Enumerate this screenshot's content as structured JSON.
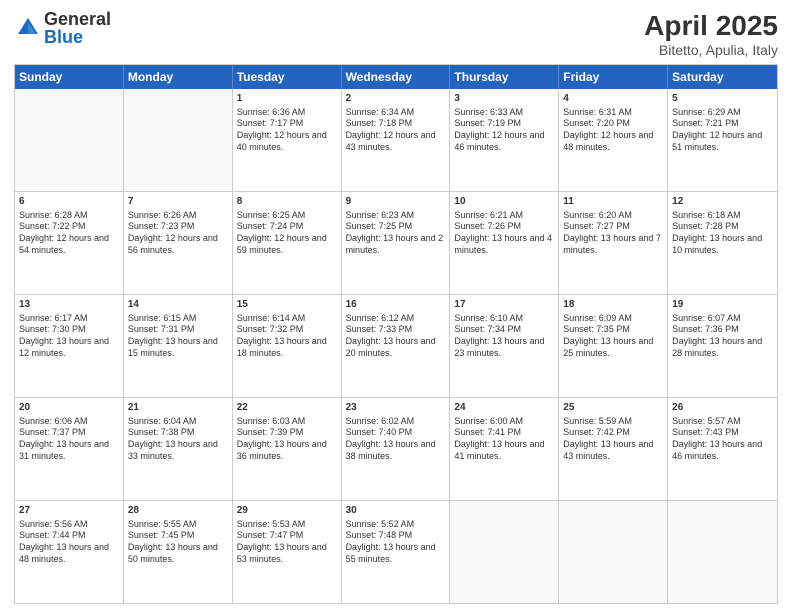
{
  "logo": {
    "general": "General",
    "blue": "Blue"
  },
  "title": "April 2025",
  "location": "Bitetto, Apulia, Italy",
  "weekdays": [
    "Sunday",
    "Monday",
    "Tuesday",
    "Wednesday",
    "Thursday",
    "Friday",
    "Saturday"
  ],
  "weeks": [
    [
      {
        "day": "",
        "info": ""
      },
      {
        "day": "",
        "info": ""
      },
      {
        "day": "1",
        "info": "Sunrise: 6:36 AM\nSunset: 7:17 PM\nDaylight: 12 hours and 40 minutes."
      },
      {
        "day": "2",
        "info": "Sunrise: 6:34 AM\nSunset: 7:18 PM\nDaylight: 12 hours and 43 minutes."
      },
      {
        "day": "3",
        "info": "Sunrise: 6:33 AM\nSunset: 7:19 PM\nDaylight: 12 hours and 46 minutes."
      },
      {
        "day": "4",
        "info": "Sunrise: 6:31 AM\nSunset: 7:20 PM\nDaylight: 12 hours and 48 minutes."
      },
      {
        "day": "5",
        "info": "Sunrise: 6:29 AM\nSunset: 7:21 PM\nDaylight: 12 hours and 51 minutes."
      }
    ],
    [
      {
        "day": "6",
        "info": "Sunrise: 6:28 AM\nSunset: 7:22 PM\nDaylight: 12 hours and 54 minutes."
      },
      {
        "day": "7",
        "info": "Sunrise: 6:26 AM\nSunset: 7:23 PM\nDaylight: 12 hours and 56 minutes."
      },
      {
        "day": "8",
        "info": "Sunrise: 6:25 AM\nSunset: 7:24 PM\nDaylight: 12 hours and 59 minutes."
      },
      {
        "day": "9",
        "info": "Sunrise: 6:23 AM\nSunset: 7:25 PM\nDaylight: 13 hours and 2 minutes."
      },
      {
        "day": "10",
        "info": "Sunrise: 6:21 AM\nSunset: 7:26 PM\nDaylight: 13 hours and 4 minutes."
      },
      {
        "day": "11",
        "info": "Sunrise: 6:20 AM\nSunset: 7:27 PM\nDaylight: 13 hours and 7 minutes."
      },
      {
        "day": "12",
        "info": "Sunrise: 6:18 AM\nSunset: 7:28 PM\nDaylight: 13 hours and 10 minutes."
      }
    ],
    [
      {
        "day": "13",
        "info": "Sunrise: 6:17 AM\nSunset: 7:30 PM\nDaylight: 13 hours and 12 minutes."
      },
      {
        "day": "14",
        "info": "Sunrise: 6:15 AM\nSunset: 7:31 PM\nDaylight: 13 hours and 15 minutes."
      },
      {
        "day": "15",
        "info": "Sunrise: 6:14 AM\nSunset: 7:32 PM\nDaylight: 13 hours and 18 minutes."
      },
      {
        "day": "16",
        "info": "Sunrise: 6:12 AM\nSunset: 7:33 PM\nDaylight: 13 hours and 20 minutes."
      },
      {
        "day": "17",
        "info": "Sunrise: 6:10 AM\nSunset: 7:34 PM\nDaylight: 13 hours and 23 minutes."
      },
      {
        "day": "18",
        "info": "Sunrise: 6:09 AM\nSunset: 7:35 PM\nDaylight: 13 hours and 25 minutes."
      },
      {
        "day": "19",
        "info": "Sunrise: 6:07 AM\nSunset: 7:36 PM\nDaylight: 13 hours and 28 minutes."
      }
    ],
    [
      {
        "day": "20",
        "info": "Sunrise: 6:06 AM\nSunset: 7:37 PM\nDaylight: 13 hours and 31 minutes."
      },
      {
        "day": "21",
        "info": "Sunrise: 6:04 AM\nSunset: 7:38 PM\nDaylight: 13 hours and 33 minutes."
      },
      {
        "day": "22",
        "info": "Sunrise: 6:03 AM\nSunset: 7:39 PM\nDaylight: 13 hours and 36 minutes."
      },
      {
        "day": "23",
        "info": "Sunrise: 6:02 AM\nSunset: 7:40 PM\nDaylight: 13 hours and 38 minutes."
      },
      {
        "day": "24",
        "info": "Sunrise: 6:00 AM\nSunset: 7:41 PM\nDaylight: 13 hours and 41 minutes."
      },
      {
        "day": "25",
        "info": "Sunrise: 5:59 AM\nSunset: 7:42 PM\nDaylight: 13 hours and 43 minutes."
      },
      {
        "day": "26",
        "info": "Sunrise: 5:57 AM\nSunset: 7:43 PM\nDaylight: 13 hours and 46 minutes."
      }
    ],
    [
      {
        "day": "27",
        "info": "Sunrise: 5:56 AM\nSunset: 7:44 PM\nDaylight: 13 hours and 48 minutes."
      },
      {
        "day": "28",
        "info": "Sunrise: 5:55 AM\nSunset: 7:45 PM\nDaylight: 13 hours and 50 minutes."
      },
      {
        "day": "29",
        "info": "Sunrise: 5:53 AM\nSunset: 7:47 PM\nDaylight: 13 hours and 53 minutes."
      },
      {
        "day": "30",
        "info": "Sunrise: 5:52 AM\nSunset: 7:48 PM\nDaylight: 13 hours and 55 minutes."
      },
      {
        "day": "",
        "info": ""
      },
      {
        "day": "",
        "info": ""
      },
      {
        "day": "",
        "info": ""
      }
    ]
  ]
}
